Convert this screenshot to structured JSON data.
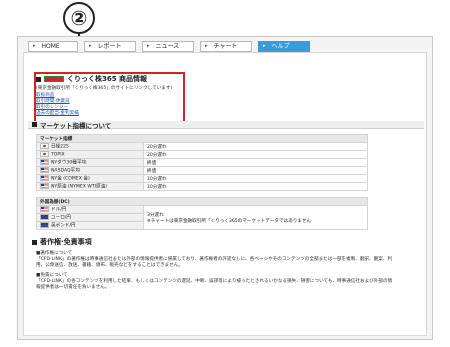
{
  "callout": {
    "number": "②"
  },
  "nav": {
    "tabs": [
      {
        "label": "HOME",
        "active": false
      },
      {
        "label": "レポート",
        "active": false
      },
      {
        "label": "ニュース",
        "active": false
      },
      {
        "label": "チャート",
        "active": false
      },
      {
        "label": "ヘルプ",
        "active": true
      }
    ]
  },
  "product": {
    "title": "くりっく株365 商品情報",
    "note": "(東京金融取引所「くりっく株365」のサイトにリンクしています)",
    "links": [
      "取扱商品",
      "取引時間·休業日",
      "取引のレンジー",
      "過去の配当·金利実績"
    ]
  },
  "market": {
    "title": "マーケット指標について",
    "section1_header": "マーケット指標",
    "rows1": [
      {
        "flag": "jp",
        "name": "日経225",
        "delay": "20分遅れ"
      },
      {
        "flag": "jp",
        "name": "TOPIX",
        "delay": "20分遅れ"
      },
      {
        "flag": "us",
        "name": "NYダウ30種平均",
        "delay": "終値"
      },
      {
        "flag": "us",
        "name": "NASDAQ平均",
        "delay": "終値"
      },
      {
        "flag": "us",
        "name": "NY金 (COMEX 金)",
        "delay": "10分遅れ"
      },
      {
        "flag": "us",
        "name": "NY原油 (NYMEX WTI原油)",
        "delay": "10分遅れ"
      }
    ],
    "section2_header": "外国為替(DC)",
    "rows2": [
      {
        "flag": "us",
        "name": "ドル/円"
      },
      {
        "flag": "eu",
        "name": "ユーロ/円"
      },
      {
        "flag": "gb",
        "name": "英ポンド/円"
      }
    ],
    "fx_delay": "3分遅れ",
    "fx_note": "※チャートは東京金融取引所「くりっく365のマーケットデータではありません"
  },
  "copyright": {
    "title": "著作権·免責事項",
    "h1": "■著作権について",
    "p1": "「CFD-LINK」の著作権は時事通信社または外部の情報提供者に帰属しており、著作権者の許諾なしに、各ページやそのコンテンツの全部または一部を複製、翻訳、翻案、利用、公衆送信、放送、書籍、頒布、販売などをすることはできません。",
    "h2": "■免責について",
    "p2": "「CFD-LINK」の各コンテンツを利用した結果、もしくはコンテンツの遅延、中断、誤謬等により被ったとされるいかなる損失、損害についても、時事通信社および外部の情報提供者は一切責任を負いません。"
  }
}
